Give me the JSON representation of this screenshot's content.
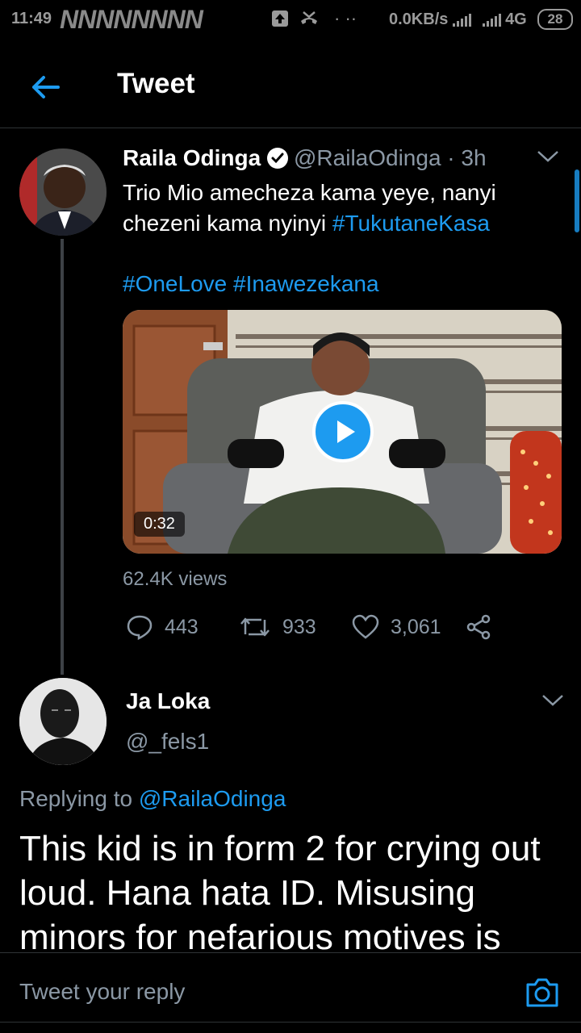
{
  "status_bar": {
    "time": "11:49",
    "notification_text": "NNNNNNNN",
    "network_speed": "0.0KB/s",
    "network_type": "4G",
    "battery": "28"
  },
  "header": {
    "back_icon": "arrow-left-icon",
    "title": "Tweet"
  },
  "tweet": {
    "author_name": "Raila Odinga",
    "handle_time": "@RailaOdinga · 3h",
    "text_plain": "Trio Mio amecheza kama yeye, nanyi chezeni kama nyinyi ",
    "hashtag_1": "#TukutaneKasa",
    "hashtag_line": "#OneLove #Inawezekana",
    "video_duration": "0:32",
    "views": "62.4K views",
    "replies": "443",
    "retweets": "933",
    "likes": "3,061"
  },
  "reply": {
    "author_name": "Ja Loka",
    "handle": "@_fels1",
    "replying_prefix": "Replying to ",
    "replying_mention": "@RailaOdinga",
    "text": "This kid is in form 2 for crying out loud. Hana hata ID. Misusing minors for nefarious motives is"
  },
  "compose": {
    "placeholder": "Tweet your reply",
    "camera_icon": "camera-icon"
  },
  "colors": {
    "accent": "#1d9bf0",
    "secondary_text": "#8b98a5",
    "background": "#000000"
  }
}
